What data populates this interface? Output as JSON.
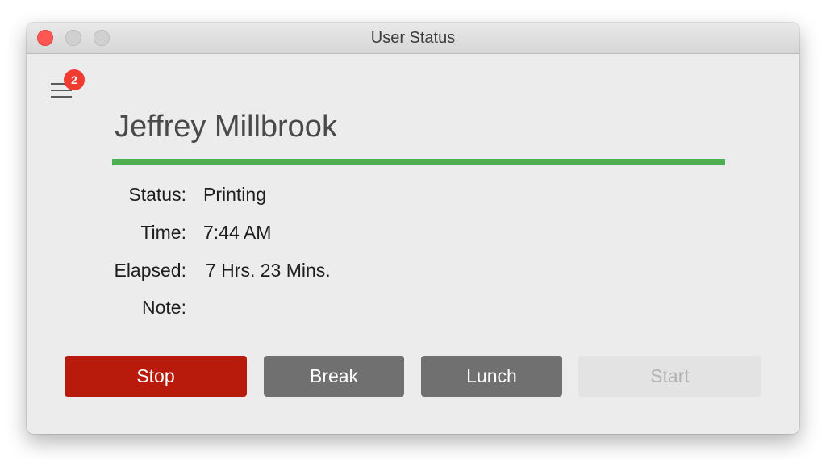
{
  "window": {
    "title": "User Status",
    "controls": [
      "close-button",
      "minimize-button",
      "zoom-button"
    ]
  },
  "menu": {
    "icon": "hamburger-menu-icon",
    "badge_count": "2"
  },
  "user": {
    "name": "Jeffrey Millbrook",
    "status_color": "#4caf50"
  },
  "info": {
    "status_label": "Status:",
    "status_value": "Printing",
    "time_label": "Time:",
    "time_value": "7:44 AM",
    "elapsed_label": "Elapsed:",
    "elapsed_value": "7 Hrs. 23 Mins.",
    "note_label": "Note:",
    "note_value": ""
  },
  "actions": {
    "stop_label": "Stop",
    "break_label": "Break",
    "lunch_label": "Lunch",
    "start_label": "Start",
    "start_enabled": false
  },
  "colors": {
    "stop": "#b81a0b",
    "secondary": "#707070",
    "disabled": "#e3e3e3",
    "badge": "#f23b30",
    "window_close": "#fc5753"
  }
}
